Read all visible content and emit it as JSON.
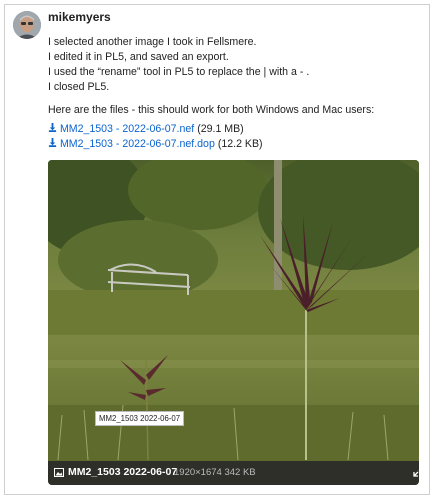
{
  "post": {
    "username": "mikemyers",
    "paragraphs": [
      "I selected another image I took in Fellsmere.",
      "I edited it in PL5, and saved an export.",
      "I used the “rename” tool in PL5 to replace the | with a - .",
      "I closed PL5.",
      "Here are the files - this should work for both Windows and Mac users:"
    ],
    "attachments": [
      {
        "name": "MM2_1503 - 2022-06-07.nef",
        "size": "(29.1 MB)"
      },
      {
        "name": "MM2_1503 - 2022-06-07.nef.dop",
        "size": "(12.2 KB)"
      }
    ]
  },
  "image": {
    "tooltip": "MM2_1503  2022-06-07",
    "filename": "MM2_1503 2022-06-07",
    "dimensions": "1920×1674 342 KB",
    "icons": {
      "meta": "image-icon",
      "expand": "expand-icon",
      "download": "download-icon"
    }
  },
  "colors": {
    "link": "#0b63ce",
    "meta_bar": "#282828"
  }
}
